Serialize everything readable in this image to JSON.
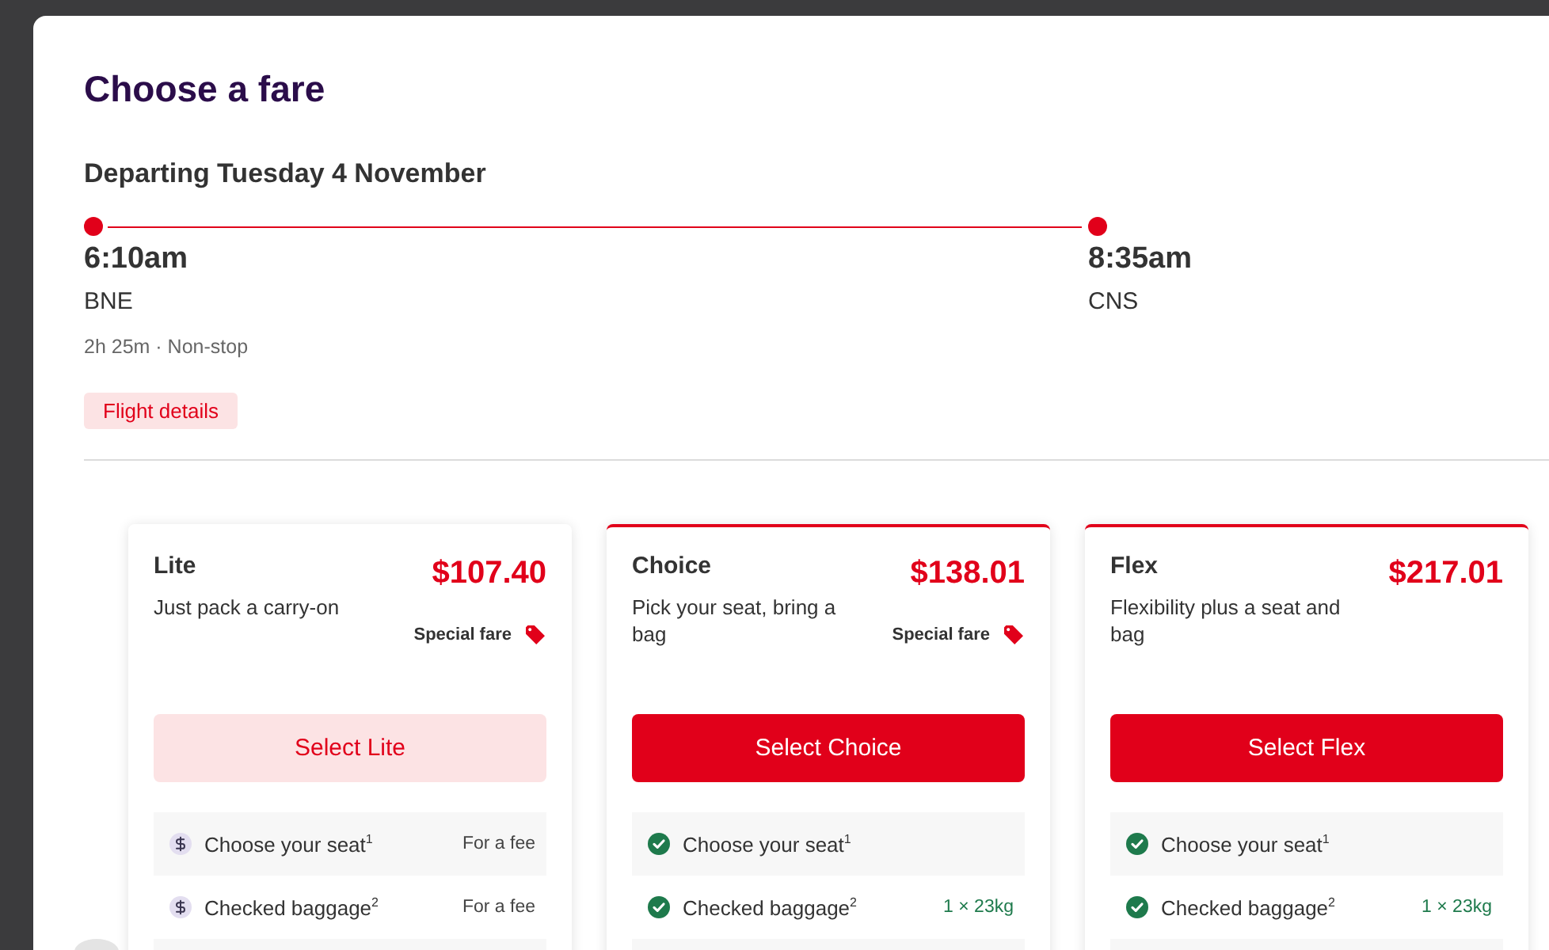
{
  "header": {
    "title": "Choose a fare"
  },
  "flight": {
    "heading": "Departing Tuesday 4 November",
    "departure": {
      "time": "6:10am",
      "airport": "BNE"
    },
    "arrival": {
      "time": "8:35am",
      "airport": "CNS"
    },
    "summary": "2h 25m · Non-stop",
    "details_button": "Flight details"
  },
  "fares": [
    {
      "name": "Lite",
      "description": "Just pack a carry-on",
      "price": "$107.40",
      "badge": "Special fare",
      "highlighted": false,
      "button": "Select Lite",
      "features": [
        {
          "kind": "fee",
          "label": "Choose your seat$^{1}$",
          "value": "For a fee"
        },
        {
          "kind": "fee",
          "label": "Checked baggage$^{2}$",
          "value": "For a fee"
        }
      ]
    },
    {
      "name": "Choice",
      "description": "Pick your seat, bring a bag",
      "price": "$138.01",
      "badge": "Special fare",
      "highlighted": true,
      "button": "Select Choice",
      "features": [
        {
          "kind": "included",
          "label": "Choose your seat$^{1}$"
        },
        {
          "kind": "included",
          "label": "Checked baggage$^{2}$",
          "value": "1 × 23kg"
        }
      ]
    },
    {
      "name": "Flex",
      "description": "Flexibility plus a seat and bag",
      "price": "$217.01",
      "highlighted": true,
      "button": "Select Flex",
      "features": [
        {
          "kind": "included",
          "label": "Choose your seat$^{1}$"
        },
        {
          "kind": "included",
          "label": "Checked baggage$^{2}$",
          "value": "1 × 23kg"
        }
      ]
    }
  ]
}
